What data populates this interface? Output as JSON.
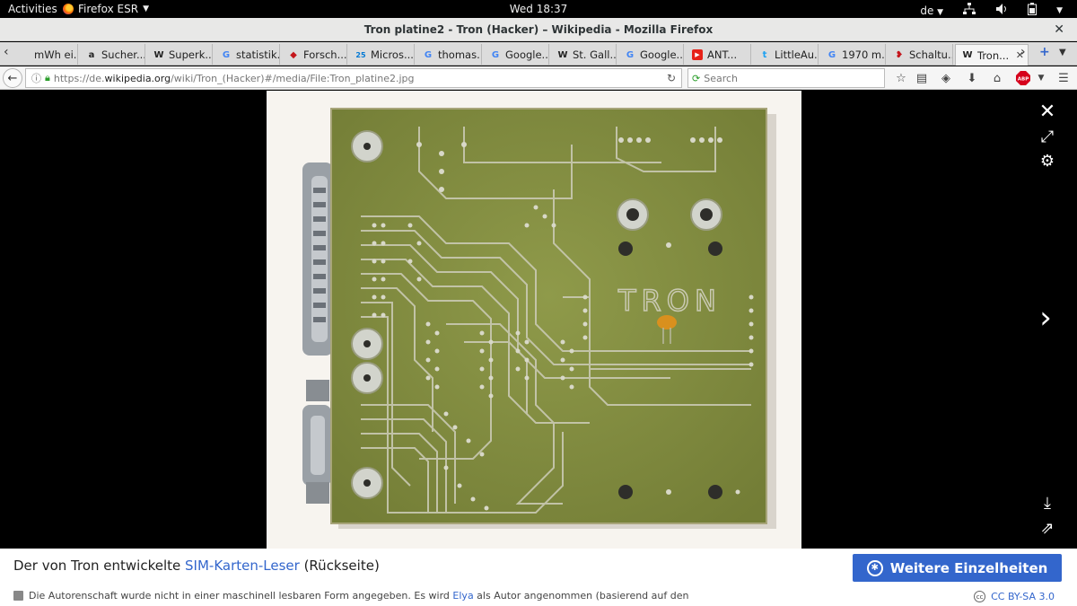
{
  "topbar": {
    "activities": "Activities",
    "app": "Firefox ESR",
    "clock": "Wed 18:37",
    "lang": "de"
  },
  "window": {
    "title": "Tron platine2 - Tron (Hacker) – Wikipedia - Mozilla Firefox"
  },
  "tabs": [
    {
      "label": "mWh ei...",
      "icon": "page-icon",
      "fav": ""
    },
    {
      "label": "Sucher...",
      "icon": "amazon-icon",
      "fav": "a"
    },
    {
      "label": "Superk...",
      "icon": "wikipedia-icon",
      "fav": "W"
    },
    {
      "label": "statistik...",
      "icon": "google-icon",
      "fav": "G"
    },
    {
      "label": "Forsch...",
      "icon": "site-icon",
      "fav": "◆"
    },
    {
      "label": "Micros...",
      "icon": "calendar-icon",
      "fav": "25"
    },
    {
      "label": "thomas...",
      "icon": "google-icon",
      "fav": "G"
    },
    {
      "label": "Google...",
      "icon": "translate-icon",
      "fav": "G"
    },
    {
      "label": "St. Gall...",
      "icon": "wikipedia-icon",
      "fav": "W"
    },
    {
      "label": "Google...",
      "icon": "translate-icon",
      "fav": "G"
    },
    {
      "label": "ANT...",
      "icon": "youtube-icon",
      "fav": "▶"
    },
    {
      "label": "LittleAu...",
      "icon": "twitter-icon",
      "fav": "t"
    },
    {
      "label": "1970 m...",
      "icon": "google-icon",
      "fav": "G"
    },
    {
      "label": "Schaltu...",
      "icon": "site-icon",
      "fav": "❥"
    },
    {
      "label": "Tron...",
      "icon": "wikipedia-icon",
      "fav": "W",
      "active": true
    }
  ],
  "nav": {
    "url_prefix": "https://de.",
    "url_host": "wikipedia.org",
    "url_rest": "/wiki/Tron_(Hacker)#/media/File:Tron_platine2.jpg",
    "search_placeholder": "Search"
  },
  "pcb": {
    "logo_text": "TRON"
  },
  "caption": {
    "text_before": "Der von Tron entwickelte ",
    "link": "SIM-Karten-Leser",
    "text_after": " (Rückseite)",
    "more_button": "Weitere Einzelheiten",
    "attrib_before": "Die Autorenschaft wurde nicht in einer maschinell lesbaren Form angegeben. Es wird ",
    "attrib_link": "Elya",
    "attrib_after": " als Autor angenommen (basierend auf den",
    "license": "CC BY-SA 3.0"
  }
}
